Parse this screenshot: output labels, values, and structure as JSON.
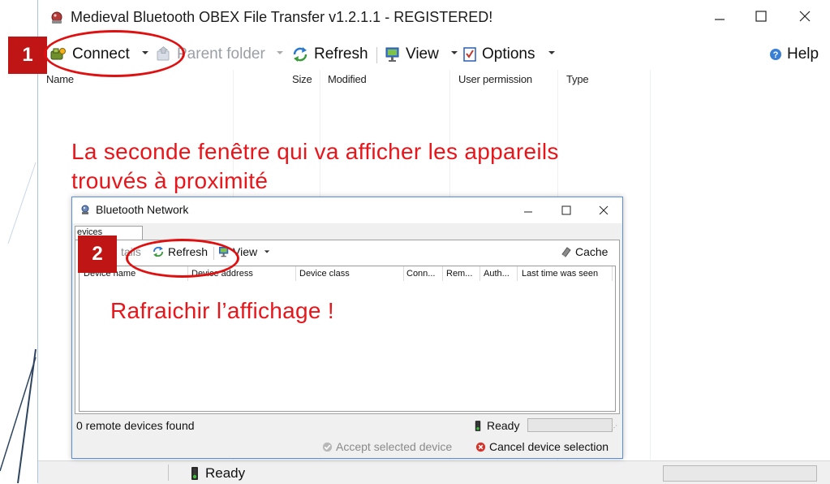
{
  "window": {
    "title": "Medieval Bluetooth OBEX File Transfer v1.2.1.1 - REGISTERED!",
    "icon": "bluetooth-app-icon"
  },
  "toolbar": {
    "connect_label": "Connect",
    "parent_folder_label": "Parent folder",
    "refresh_label": "Refresh",
    "view_label": "View",
    "options_label": "Options",
    "help_label": "Help"
  },
  "file_columns": [
    "Name",
    "Size",
    "Modified",
    "User permission",
    "Type"
  ],
  "status": {
    "text": "Ready"
  },
  "annotations": {
    "badge_1": "1",
    "badge_2": "2",
    "caption_1_line1": "La seconde fenêtre qui va afficher les appareils",
    "caption_1_line2": "trouvés à proximité",
    "caption_2": "Rafraichir l’affichage !",
    "accent_color": "#e8161b"
  },
  "bluetooth_network": {
    "title": "Bluetooth Network",
    "tab_label": "evices",
    "toolbar": {
      "details_label": "tails",
      "refresh_label": "Refresh",
      "view_label": "View",
      "cache_label": "Cache"
    },
    "columns": [
      "Device name",
      "Device address",
      "Device class",
      "Conn...",
      "Rem...",
      "Auth...",
      "Last time was seen"
    ],
    "status_left": "0 remote devices found",
    "status_ready": "Ready",
    "accept_label": "Accept selected device",
    "cancel_label": "Cancel device selection"
  }
}
